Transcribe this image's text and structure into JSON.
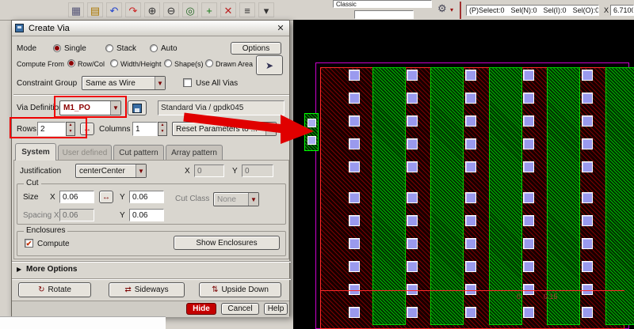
{
  "colors": {
    "annotation_red": "#ee0000",
    "hide_button_red": "#c40000",
    "canvas_metal_red": "#7d0000",
    "canvas_poly_green": "#00b300",
    "canvas_boundary_purple": "#cc00cc",
    "via_fill_blue": "#9a9aee"
  },
  "toolbar": {
    "icons": [
      {
        "name": "grid-icon",
        "glyph": "▦",
        "color": "#555577"
      },
      {
        "name": "clipboard-icon",
        "glyph": "▤",
        "color": "#aa7700"
      },
      {
        "name": "undo-icon",
        "glyph": "↶",
        "color": "#2244cc"
      },
      {
        "name": "redo-icon",
        "glyph": "↷",
        "color": "#cc2222"
      },
      {
        "name": "zoom-in-icon",
        "glyph": "⊕",
        "color": "#333333"
      },
      {
        "name": "zoom-out-icon",
        "glyph": "⊖",
        "color": "#333333"
      },
      {
        "name": "fit-view-icon",
        "glyph": "◎",
        "color": "#226622"
      },
      {
        "name": "add-icon",
        "glyph": "+",
        "color": "#117711"
      },
      {
        "name": "delete-icon",
        "glyph": "✕",
        "color": "#bb2222"
      },
      {
        "name": "menu-icon",
        "glyph": "≡",
        "color": "#333333"
      },
      {
        "name": "dropdown-arrow-icon",
        "glyph": "▾",
        "color": "#333333"
      }
    ],
    "workspace_combo": "Classic",
    "toolbar_input_value": "",
    "gear_glyph": "⚙",
    "gear_arrow_glyph": "▾",
    "status": {
      "pselect": "(P)Select:0",
      "sel_n": "Sel(N):0",
      "sel_i": "Sel(I):0",
      "sel_o": "Sel(O):0",
      "x_label": "X",
      "x_value": "6.7100"
    }
  },
  "dialog": {
    "title": "Create Via",
    "close_glyph": "✕",
    "mode": {
      "label": "Mode",
      "single": "Single",
      "stack": "Stack",
      "auto": "Auto",
      "selected": "Single"
    },
    "options_button": "Options",
    "pick_button_glyph": "➤",
    "compute_from": {
      "label": "Compute From",
      "row_col": "Row/Col",
      "width_height": "Width/Height",
      "shapes": "Shape(s)",
      "drawn_area": "Drawn Area",
      "selected": "Row/Col"
    },
    "constraint_group": {
      "label": "Constraint Group",
      "value": "Same as Wire",
      "use_all_vias_label": "Use All Vias",
      "use_all_vias_checked": false
    },
    "via_definition": {
      "label": "Via Definition",
      "value": "M1_PO",
      "standard_text": "Standard Via / gpdk045"
    },
    "rows_label": "Rows",
    "rows_value": "2",
    "columns_label": "Columns",
    "columns_value": "1",
    "link_glyph": "↔",
    "reset_button": "Reset Parameters to ...",
    "tabs": {
      "system": "System",
      "user_defined": "User defined",
      "cut_pattern": "Cut pattern",
      "array_pattern": "Array pattern",
      "active": "System"
    },
    "justification": {
      "label": "Justification",
      "value": "centerCenter",
      "x_label": "X",
      "x_value": "0",
      "y_label": "Y",
      "y_value": "0"
    },
    "cut": {
      "legend": "Cut",
      "size_label": "Size",
      "x_label": "X",
      "y_label": "Y",
      "size_x": "0.06",
      "size_y": "0.06",
      "cut_class_label": "Cut Class",
      "cut_class_value": "None",
      "spacing_label": "Spacing X",
      "spacing_x": "0.06",
      "spacing_y_label": "Y",
      "spacing_y": "0.06"
    },
    "enclosures": {
      "legend": "Enclosures",
      "compute_label": "Compute",
      "compute_checked": true,
      "show_button": "Show Enclosures"
    },
    "more_options": {
      "arrow_glyph": "▶",
      "label": "More Options"
    },
    "transform": {
      "rotate": "Rotate",
      "rotate_glyph": "↻",
      "sideways": "Sideways",
      "sideways_glyph": "⇄",
      "upside_down": "Upside Down",
      "upside_down_glyph": "⇅"
    },
    "footer": {
      "hide": "Hide",
      "cancel": "Cancel",
      "help": "Help"
    },
    "checkmark_glyph": "✔"
  },
  "canvas": {
    "ruler_label_left": "0",
    "ruler_label_right": "0.15"
  }
}
